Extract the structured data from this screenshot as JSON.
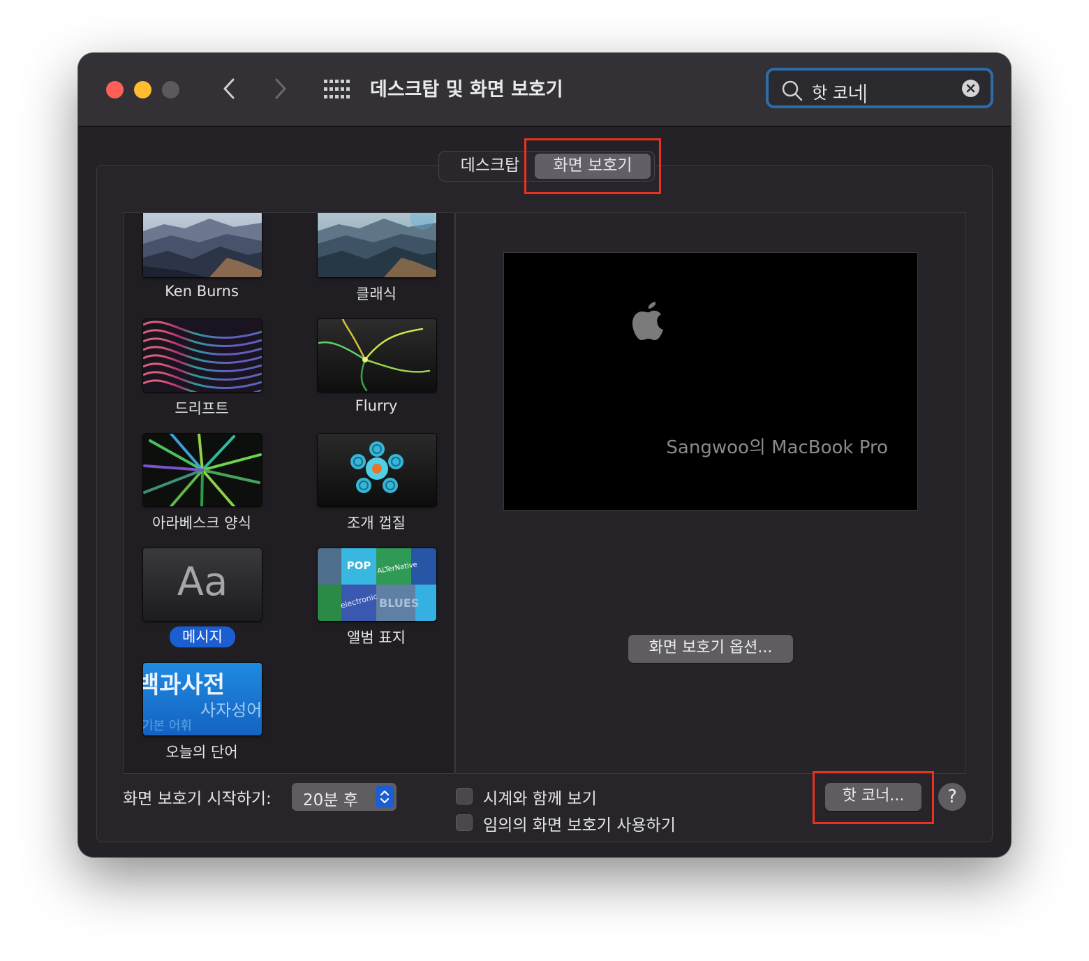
{
  "window": {
    "title": "데스크탑 및 화면 보호기"
  },
  "search": {
    "value": "핫 코너"
  },
  "tabs": [
    {
      "label": "데스크탑",
      "selected": false
    },
    {
      "label": "화면 보호기",
      "selected": true
    }
  ],
  "screensavers": [
    {
      "label": "Ken Burns",
      "selected": false
    },
    {
      "label": "클래식",
      "selected": false
    },
    {
      "label": "드리프트",
      "selected": false
    },
    {
      "label": "Flurry",
      "selected": false
    },
    {
      "label": "아라베스크 양식",
      "selected": false
    },
    {
      "label": "조개 껍질",
      "selected": false
    },
    {
      "label": "메시지",
      "selected": true
    },
    {
      "label": "앨범 표지",
      "selected": false
    },
    {
      "label": "오늘의 단어",
      "selected": false
    }
  ],
  "thumb_text": {
    "message": "Aa",
    "word_main": "백과사전",
    "word_sub": "사자성어",
    "word_small": "기본 어휘",
    "album_pop": "POP",
    "album_alt": "ALTerNative",
    "album_electro": "electronic",
    "album_blues": "BLUES"
  },
  "preview": {
    "message": "Sangwoo의 MacBook Pro"
  },
  "options_button": "화면 보호기 옵션...",
  "start_after": {
    "label": "화면 보호기 시작하기:",
    "value": "20분 후"
  },
  "checkboxes": [
    {
      "label": "시계와 함께 보기",
      "checked": false
    },
    {
      "label": "임의의 화면 보호기 사용하기",
      "checked": false
    }
  ],
  "hot_corners_button": "핫 코너...",
  "help_button": "?",
  "colors": {
    "accent": "#1a5ed1",
    "highlight_box": "#e8321f",
    "search_focus": "#2f6da8"
  }
}
